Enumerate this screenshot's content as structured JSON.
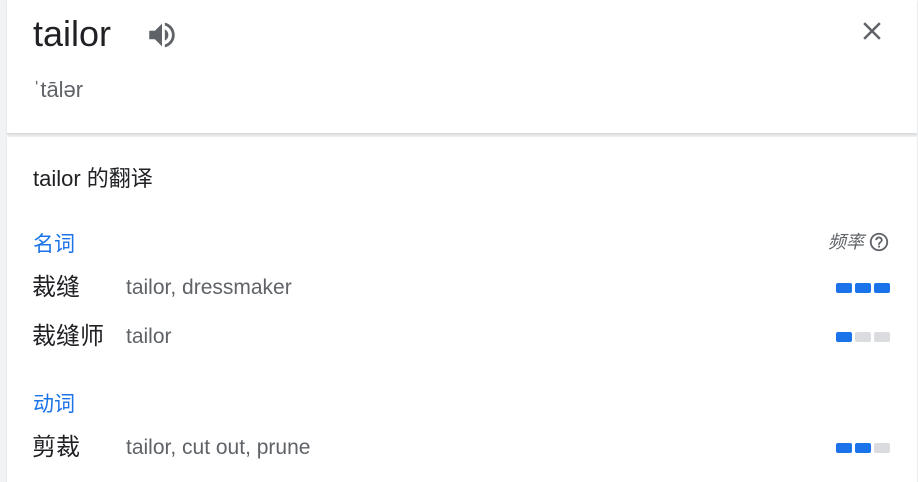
{
  "header": {
    "word": "tailor",
    "phonetic": "ˈtālər",
    "speaker_icon": "speaker-icon",
    "close_icon": "close-icon"
  },
  "translations": {
    "title": "tailor 的翻译",
    "frequency_label": "频率",
    "help_icon": "help-circle-icon",
    "accent_color": "#1a73e8",
    "groups": [
      {
        "pos": "名词",
        "entries": [
          {
            "zh": "裁缝",
            "en": "tailor, dressmaker",
            "frequency": 3
          },
          {
            "zh": "裁缝师",
            "en": "tailor",
            "frequency": 1
          }
        ]
      },
      {
        "pos": "动词",
        "entries": [
          {
            "zh": "剪裁",
            "en": "tailor, cut out, prune",
            "frequency": 2
          }
        ]
      }
    ]
  }
}
